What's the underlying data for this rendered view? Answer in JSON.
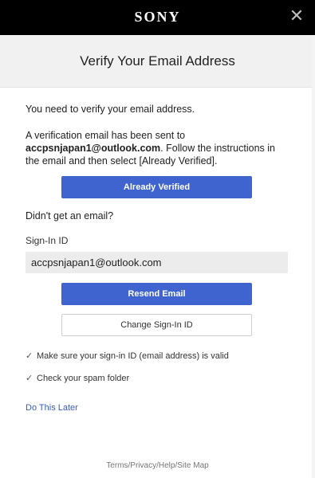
{
  "topbar": {
    "logo_text": "SONY",
    "close_glyph": "✕"
  },
  "header": {
    "title": "Verify Your Email Address"
  },
  "main": {
    "intro": "You need to verify your email address.",
    "sent_prefix": "A verification email has been sent to",
    "email_bold": "accpsnjapan1@outlook.com",
    "sent_suffix": ". Follow the instructions in the email and then select [Already Verified].",
    "already_verified_label": "Already Verified",
    "didnt_get": "Didn't get an email?",
    "signin_label": "Sign-In ID",
    "signin_value": "accpsnjapan1@outlook.com",
    "resend_label": "Resend Email",
    "change_label": "Change Sign-In ID",
    "tips": [
      "Make sure your sign-in ID (email address) is valid",
      "Check your spam folder"
    ],
    "later_link": "Do This Later"
  },
  "footer": {
    "links": [
      "Terms",
      "Privacy",
      "Help",
      "Site Map"
    ],
    "separator": "/"
  },
  "colors": {
    "primary": "#3f64cf",
    "topbar": "#000000",
    "link": "#3a5bbf"
  },
  "icons": {
    "close": "close-icon",
    "check": "check-icon"
  }
}
